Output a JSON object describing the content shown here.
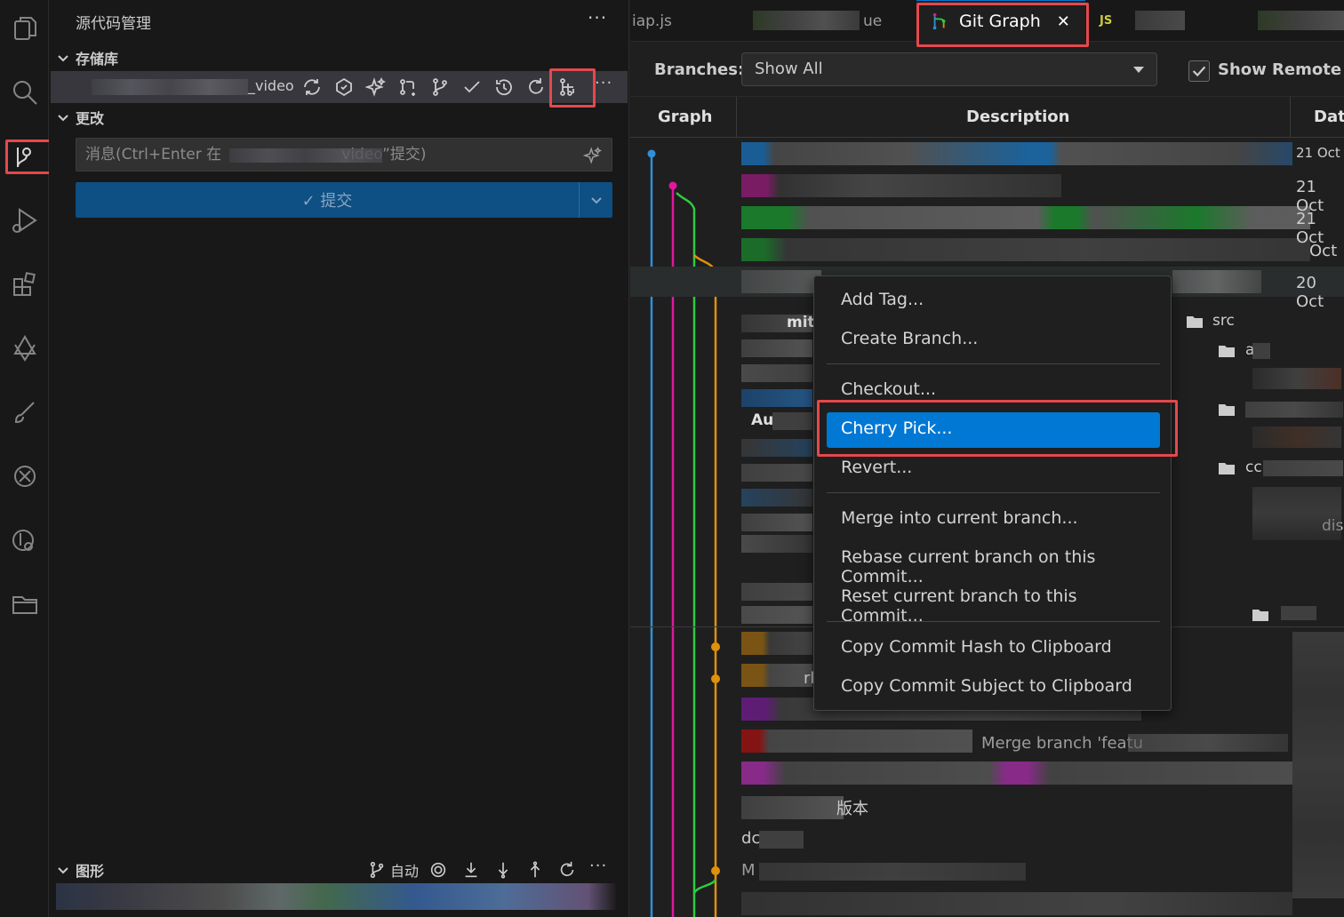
{
  "sidebar": {
    "title": "源代码管理",
    "repositories_header": "存储库",
    "repo_name": "_video",
    "changes_header": "更改",
    "message_placeholder": "消息(Ctrl+Enter 在                         video”提交)",
    "commit_label": "✓ 提交",
    "graph_header": "图形",
    "graph_auto_label": "自动",
    "more": "···"
  },
  "tabs": {
    "left_partial": "iap.js",
    "mid_partial": "ue",
    "active": "Git Graph",
    "close": "✕",
    "js_badge": "JS"
  },
  "git_graph": {
    "branches_label": "Branches:",
    "branches_value": "Show All",
    "show_remote_label": "Show Remote B",
    "columns": {
      "graph": "Graph",
      "description": "Description",
      "date": "Dat"
    },
    "dates": [
      "21 Oct",
      "21 Oct",
      "Oct",
      "20 Oct"
    ],
    "partial_texts": [
      "Merge branch 'featu",
      "版本",
      "dc",
      "M",
      "rl",
      "mit",
      "Au"
    ]
  },
  "context_menu": {
    "items": [
      {
        "label": "Add Tag..."
      },
      {
        "label": "Create Branch..."
      },
      {
        "label": "Checkout..."
      },
      {
        "label": "Cherry Pick...",
        "selected": true
      },
      {
        "label": "Revert..."
      },
      {
        "label": "Merge into current branch..."
      },
      {
        "label": "Rebase current branch on this Commit..."
      },
      {
        "label": "Reset current branch to this Commit..."
      },
      {
        "label": "Copy Commit Hash to Clipboard"
      },
      {
        "label": "Copy Commit Subject to Clipboard"
      }
    ]
  },
  "file_tree": {
    "src": "src",
    "a": "a",
    "cc": "cc",
    "dis": "dis"
  },
  "colors": {
    "accent": "#0078d4",
    "highlight": "#e5484d",
    "branch_blue": "#2f8fd8",
    "branch_pink": "#e0189a",
    "branch_green": "#2ecc40",
    "branch_orange": "#e0900c"
  }
}
